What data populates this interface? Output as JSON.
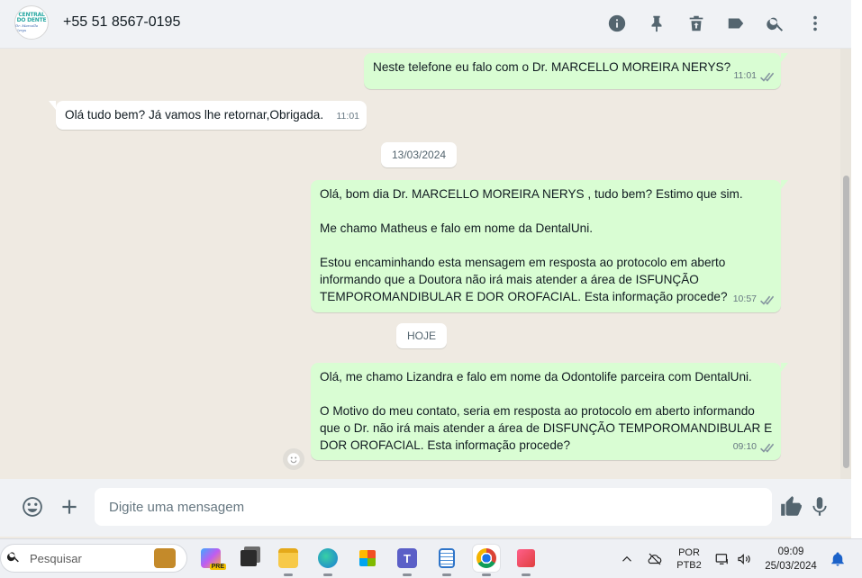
{
  "header": {
    "avatar_line1": "CENTRAL",
    "avatar_line2": "DO DENTE",
    "avatar_line3": "Dr. Marcello Nerys",
    "contact": "+55 51 8567-0195",
    "icons": [
      "info-icon",
      "pin-icon",
      "archive-icon",
      "label-icon",
      "search-icon",
      "more-vertical-icon"
    ]
  },
  "messages": [
    {
      "dir": "out",
      "text": "Neste telefone eu falo com o Dr. MARCELLO MOREIRA NERYS?",
      "time": "11:01",
      "status": "read"
    },
    {
      "dir": "in",
      "text": "Olá tudo bem? Já vamos lhe retornar,Obrigada.",
      "time": "11:01"
    },
    {
      "dir": "date",
      "text": "13/03/2024"
    },
    {
      "dir": "out",
      "text": "Olá, bom dia Dr. MARCELLO MOREIRA NERYS , tudo bem? Estimo que sim.\n\nMe chamo Matheus e falo em nome da DentalUni.\n\nEstou encaminhando esta mensagem em resposta ao protocolo em aberto\ninformando que a Doutora não irá mais atender a área de ISFUNÇÃO\nTEMPOROMANDIBULAR E DOR OROFACIAL. Esta informação procede?",
      "time": "10:57",
      "status": "read"
    },
    {
      "dir": "date",
      "text": "HOJE"
    },
    {
      "dir": "out",
      "text": "Olá, me chamo Lizandra e falo em nome da Odontolife parceira com DentalUni.\n\nO Motivo do meu contato, seria em resposta ao protocolo em aberto informando\nque o Dr. não irá mais atender a área de DISFUNÇÃO TEMPOROMANDIBULAR E\nDOR OROFACIAL. Esta informação procede?",
      "time": "09:10",
      "status": "read"
    }
  ],
  "composer": {
    "placeholder": "Digite uma mensagem",
    "icons": [
      "emoji-icon",
      "plus-icon",
      "thumbs-up-icon",
      "microphone-icon"
    ]
  },
  "taskbar": {
    "search_placeholder": "Pesquisar",
    "apps": [
      "copilot-icon",
      "task-view-icon",
      "file-explorer-icon",
      "edge-icon",
      "store-icon",
      "teams-icon",
      "notepad-icon",
      "chrome-icon",
      "snipping-tool-icon"
    ],
    "copilot_badge": "PRE",
    "lang_line1": "POR",
    "lang_line2": "PTB2",
    "time": "09:09",
    "date": "25/03/2024"
  },
  "colors": {
    "outgoing_bubble": "#d9fdd3",
    "incoming_bubble": "#ffffff",
    "chat_background": "#efeae2",
    "header_background": "#f0f2f5"
  }
}
